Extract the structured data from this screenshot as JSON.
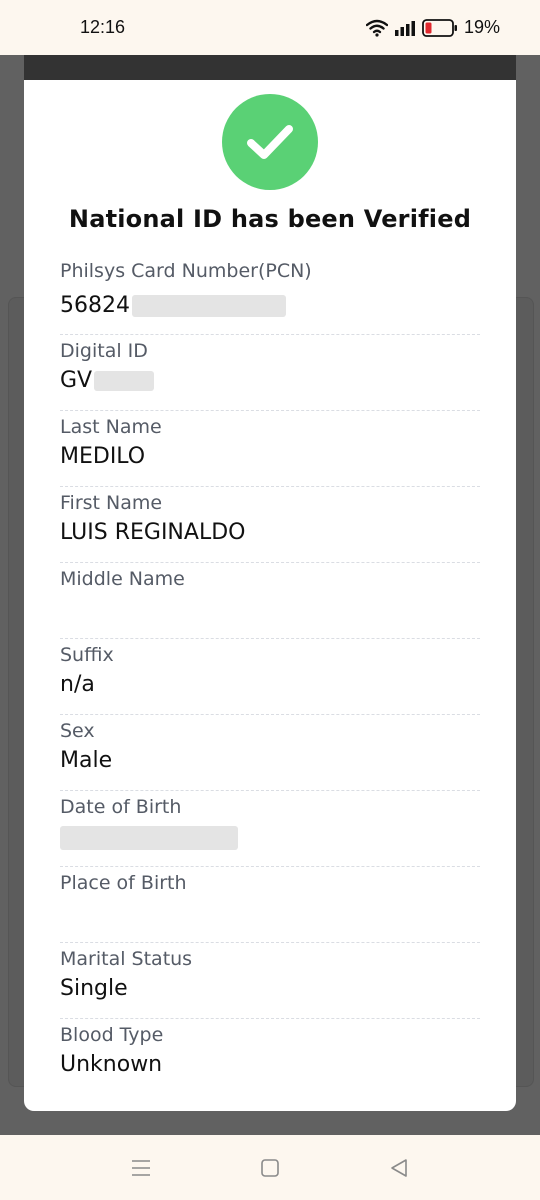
{
  "status_bar": {
    "time": "12:16",
    "battery_percent": "19%",
    "battery_level": 0.19
  },
  "modal": {
    "title": "National ID has been Verified",
    "check_color": "#5ad175",
    "fields": [
      {
        "label": "Philsys Card Number(PCN)",
        "value": "56824"
      },
      {
        "label": "Digital ID",
        "value": "GV"
      },
      {
        "label": "Last Name",
        "value": "MEDILO"
      },
      {
        "label": "First Name",
        "value": "LUIS REGINALDO"
      },
      {
        "label": "Middle Name",
        "value": ""
      },
      {
        "label": "Suffix",
        "value": "n/a"
      },
      {
        "label": "Sex",
        "value": "Male"
      },
      {
        "label": "Date of Birth",
        "value": ""
      },
      {
        "label": "Place of Birth",
        "value": ""
      },
      {
        "label": "Marital Status",
        "value": "Single"
      },
      {
        "label": "Blood Type",
        "value": "Unknown"
      }
    ]
  },
  "nav_bar": {
    "recents_icon": "menu-lines-icon",
    "home_icon": "square-home-icon",
    "back_icon": "triangle-back-icon"
  }
}
